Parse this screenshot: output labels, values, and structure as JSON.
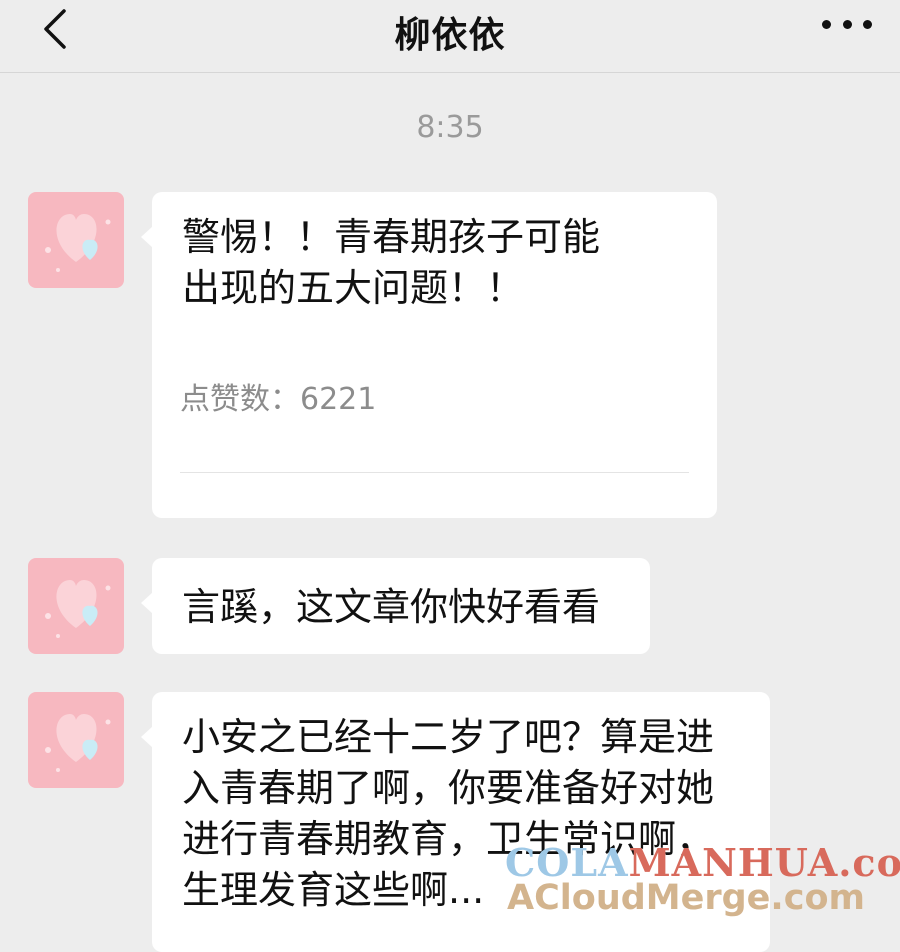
{
  "header": {
    "back_icon": "chevron-left-icon",
    "title": "柳依依",
    "more_icon": "more-horizontal-icon"
  },
  "timestamp": "8:35",
  "messages": [
    {
      "type": "article",
      "title": "警惕！！青春期孩子可能出现的五大问题！！",
      "likes_label": "点赞数：",
      "likes_value": "6221"
    },
    {
      "type": "text",
      "text": "言蹊，这文章你快好看看"
    },
    {
      "type": "text",
      "text": "小安之已经十二岁了吧？算是进入青春期了啊，你要准备好对她进行青春期教育，卫生常识啊，生理发育这些啊..."
    }
  ],
  "watermark": {
    "line1_a": "COLA",
    "line1_b": "MANHUA.com",
    "line2": "ACloudMerge.com"
  },
  "colors": {
    "background": "#ededed",
    "bubble": "#ffffff",
    "avatar_pink": "#f6b5bd",
    "avatar_blue": "#bfe8f3"
  }
}
